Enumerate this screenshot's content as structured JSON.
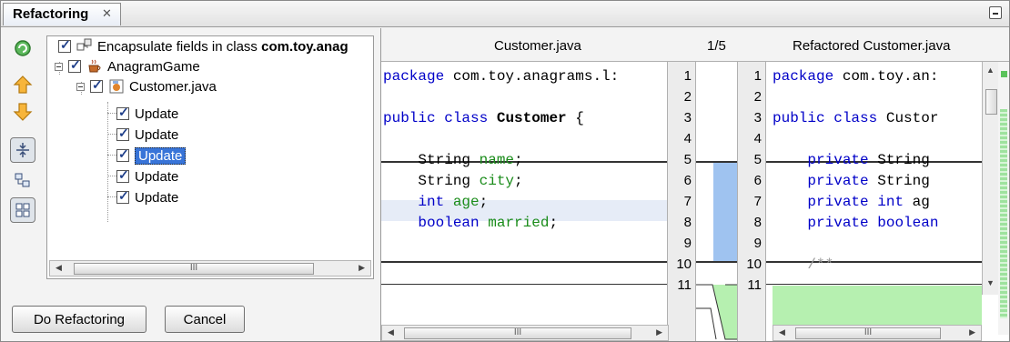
{
  "panel": {
    "tab_title": "Refactoring",
    "tab_close_glyph": "✕"
  },
  "toolbar": {
    "refresh_icon": "refresh-icon",
    "up_icon": "arrow-up-icon",
    "down_icon": "arrow-down-icon",
    "collapse_icon": "collapse-icon",
    "logical_view_icon": "logical-view-icon",
    "physical_view_icon": "physical-view-icon"
  },
  "tree": {
    "root_label_prefix": "Encapsulate fields in class ",
    "root_label_bold": "com.toy.anag",
    "project_label": "AnagramGame",
    "file_label": "Customer.java",
    "updates": [
      "Update",
      "Update",
      "Update",
      "Update",
      "Update"
    ],
    "selected_index": 2
  },
  "buttons": {
    "do_refactoring": "Do Refactoring",
    "cancel": "Cancel"
  },
  "scroll": {
    "thumb_glyph": "III"
  },
  "diff": {
    "left_title": "Customer.java",
    "counter": "1/5",
    "right_title": "Refactored Customer.java",
    "left_lines": [
      {
        "num": "1",
        "text": "package com.toy.anagrams.l:"
      },
      {
        "num": "2",
        "text": ""
      },
      {
        "num": "3",
        "text": "public class Customer {"
      },
      {
        "num": "4",
        "text": ""
      },
      {
        "num": "5",
        "text": "    String name;"
      },
      {
        "num": "6",
        "text": "    String city;"
      },
      {
        "num": "7",
        "text": "    int age;"
      },
      {
        "num": "8",
        "text": "    boolean married;"
      },
      {
        "num": "9",
        "text": ""
      },
      {
        "num": "10",
        "text": ""
      },
      {
        "num": "11",
        "text": ""
      }
    ],
    "right_lines": [
      {
        "num": "1",
        "text": "package com.toy.an:"
      },
      {
        "num": "2",
        "text": ""
      },
      {
        "num": "3",
        "text": "public class Custor"
      },
      {
        "num": "4",
        "text": ""
      },
      {
        "num": "5",
        "text": "    private String"
      },
      {
        "num": "6",
        "text": "    private String"
      },
      {
        "num": "7",
        "text": "    private int ag"
      },
      {
        "num": "8",
        "text": "    private boolean"
      },
      {
        "num": "9",
        "text": ""
      },
      {
        "num": "10",
        "text": "    /**"
      },
      {
        "num": "11",
        "text": ""
      }
    ]
  },
  "colors": {
    "changed_blue": "#9fc3f0",
    "added_green": "#b6f0b0",
    "selection": "#3874d8"
  }
}
